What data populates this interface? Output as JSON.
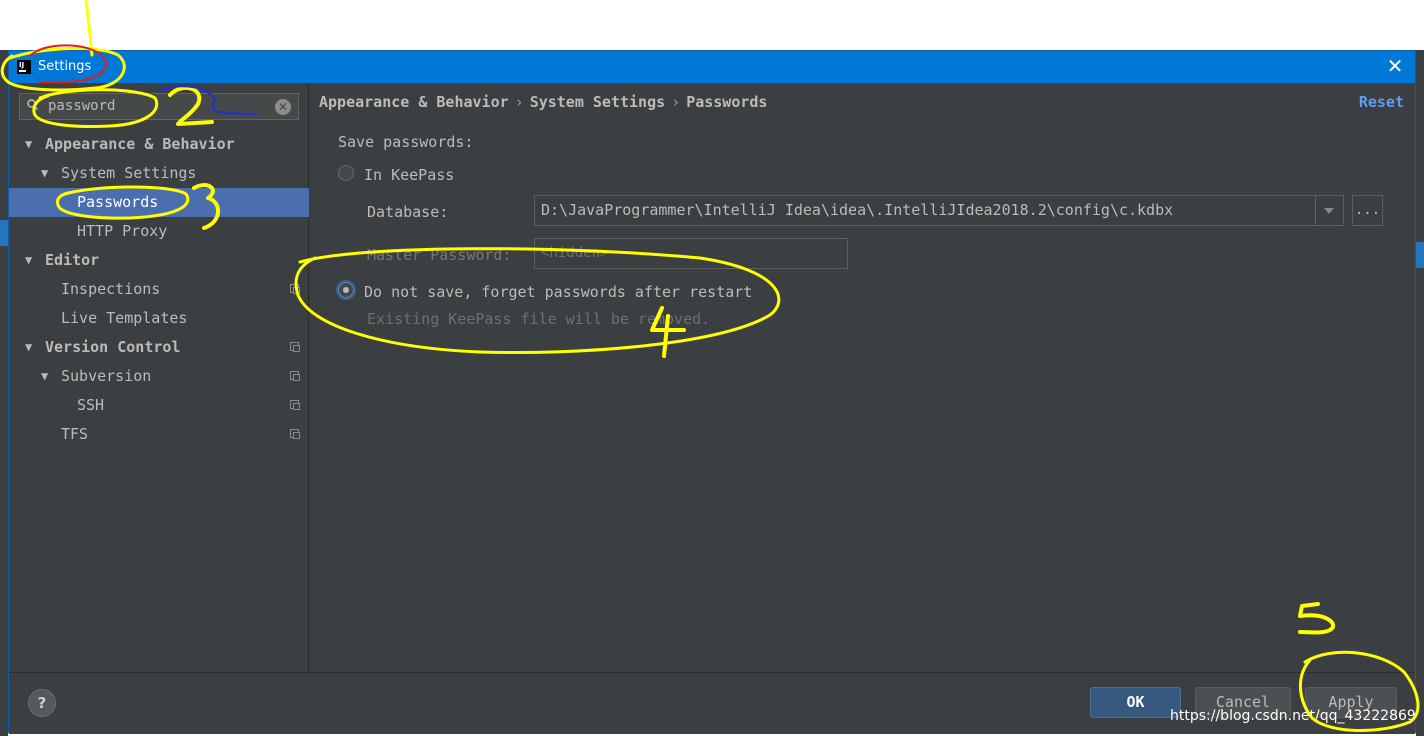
{
  "window": {
    "title": "Settings"
  },
  "search": {
    "value": "password"
  },
  "sidebar": {
    "items": [
      {
        "label": "Appearance & Behavior"
      },
      {
        "label": "System Settings"
      },
      {
        "label": "Passwords"
      },
      {
        "label": "HTTP Proxy"
      },
      {
        "label": "Editor"
      },
      {
        "label": "Inspections"
      },
      {
        "label": "Live Templates"
      },
      {
        "label": "Version Control"
      },
      {
        "label": "Subversion"
      },
      {
        "label": "SSH"
      },
      {
        "label": "TFS"
      }
    ]
  },
  "main": {
    "breadcrumb": [
      "Appearance & Behavior",
      "System Settings",
      "Passwords"
    ],
    "reset_label": "Reset",
    "save_label": "Save passwords:",
    "option_keepass": "In KeePass",
    "database_label": "Database:",
    "database_value": "D:\\JavaProgrammer\\IntelliJ Idea\\idea\\.IntelliJIdea2018.2\\config\\c.kdbx",
    "browse_label": "...",
    "master_password_label": "Master Password:",
    "master_password_value": "<hidden>",
    "option_no_save": "Do not save, forget passwords after restart",
    "hint": "Existing KeePass file will be removed.",
    "selected_option": "no_save"
  },
  "footer": {
    "help_label": "?",
    "ok_label": "OK",
    "cancel_label": "Cancel",
    "apply_label": "Apply"
  },
  "watermark": "https://blog.csdn.net/qq_43222869",
  "annotations": {
    "numbers": [
      "2",
      "3",
      "4",
      "5"
    ]
  },
  "colors": {
    "titlebar": "#0078d7",
    "selection": "#4b6eaf",
    "background": "#3c3f41",
    "link": "#589df6",
    "annotation": "#ffff00"
  }
}
